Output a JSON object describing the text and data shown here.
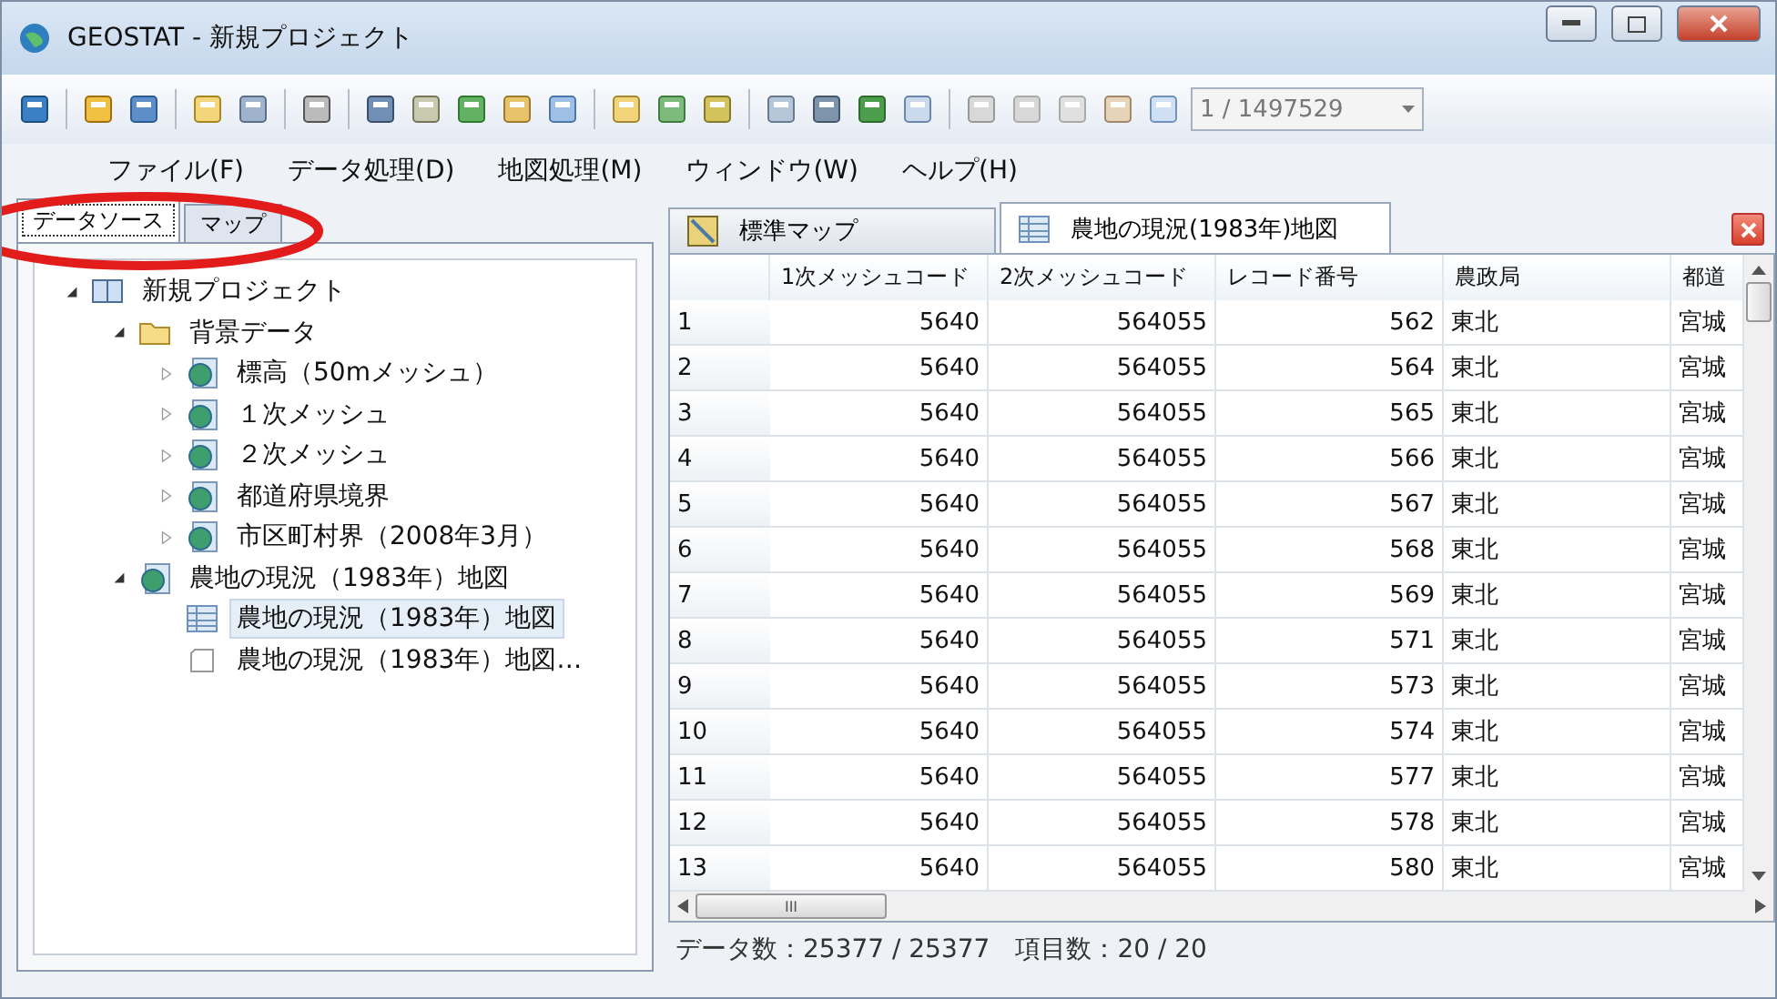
{
  "window": {
    "title": "GEOSTAT - 新規プロジェクト"
  },
  "toolbar": {
    "page_counter": "1 / 1497529"
  },
  "menu": [
    {
      "label": "ファイル(F)"
    },
    {
      "label": "データ処理(D)"
    },
    {
      "label": "地図処理(M)"
    },
    {
      "label": "ウィンドウ(W)"
    },
    {
      "label": "ヘルプ(H)"
    }
  ],
  "left_tabs": [
    {
      "label": "データソース",
      "selected": true
    },
    {
      "label": "マップ",
      "selected": false
    }
  ],
  "tree": [
    {
      "label": "新規プロジェクト",
      "kind": "project",
      "expanded": true,
      "selected": false,
      "children": [
        {
          "label": "背景データ",
          "kind": "folder",
          "expanded": true,
          "selected": false,
          "children": [
            {
              "label": "標高（50mメッシュ）",
              "kind": "layer",
              "expanded": false,
              "selected": false
            },
            {
              "label": "１次メッシュ",
              "kind": "layer",
              "expanded": false,
              "selected": false
            },
            {
              "label": "２次メッシュ",
              "kind": "layer",
              "expanded": false,
              "selected": false
            },
            {
              "label": "都道府県境界",
              "kind": "layer",
              "expanded": false,
              "selected": false
            },
            {
              "label": "市区町村界（2008年3月）",
              "kind": "layer",
              "expanded": false,
              "selected": false
            }
          ]
        },
        {
          "label": "農地の現況（1983年）地図",
          "kind": "layer",
          "expanded": true,
          "selected": false,
          "children": [
            {
              "label": "農地の現況（1983年）地図",
              "kind": "table",
              "selected": true
            },
            {
              "label": "農地の現況（1983年）地図…",
              "kind": "page",
              "selected": false
            }
          ]
        }
      ]
    }
  ],
  "doc_tabs": [
    {
      "label": "標準マップ",
      "kind": "map",
      "selected": false
    },
    {
      "label": "農地の現況(1983年)地図",
      "kind": "table",
      "selected": true
    }
  ],
  "table": {
    "columns": [
      "1次メッシュコード",
      "2次メッシュコード",
      "レコード番号",
      "農政局",
      "都道"
    ],
    "rows": [
      {
        "index": "1",
        "cells": [
          "5640",
          "564055",
          "562",
          "東北",
          "宮城"
        ]
      },
      {
        "index": "2",
        "cells": [
          "5640",
          "564055",
          "564",
          "東北",
          "宮城"
        ]
      },
      {
        "index": "3",
        "cells": [
          "5640",
          "564055",
          "565",
          "東北",
          "宮城"
        ]
      },
      {
        "index": "4",
        "cells": [
          "5640",
          "564055",
          "566",
          "東北",
          "宮城"
        ]
      },
      {
        "index": "5",
        "cells": [
          "5640",
          "564055",
          "567",
          "東北",
          "宮城"
        ]
      },
      {
        "index": "6",
        "cells": [
          "5640",
          "564055",
          "568",
          "東北",
          "宮城"
        ]
      },
      {
        "index": "7",
        "cells": [
          "5640",
          "564055",
          "569",
          "東北",
          "宮城"
        ]
      },
      {
        "index": "8",
        "cells": [
          "5640",
          "564055",
          "571",
          "東北",
          "宮城"
        ]
      },
      {
        "index": "9",
        "cells": [
          "5640",
          "564055",
          "573",
          "東北",
          "宮城"
        ]
      },
      {
        "index": "10",
        "cells": [
          "5640",
          "564055",
          "574",
          "東北",
          "宮城"
        ]
      },
      {
        "index": "11",
        "cells": [
          "5640",
          "564055",
          "577",
          "東北",
          "宮城"
        ]
      },
      {
        "index": "12",
        "cells": [
          "5640",
          "564055",
          "578",
          "東北",
          "宮城"
        ]
      },
      {
        "index": "13",
        "cells": [
          "5640",
          "564055",
          "580",
          "東北",
          "宮城"
        ]
      }
    ],
    "scroll_grip": "III"
  },
  "status_bar": [
    "データ数：25377 / 25377",
    "項目数：20 / 20"
  ]
}
